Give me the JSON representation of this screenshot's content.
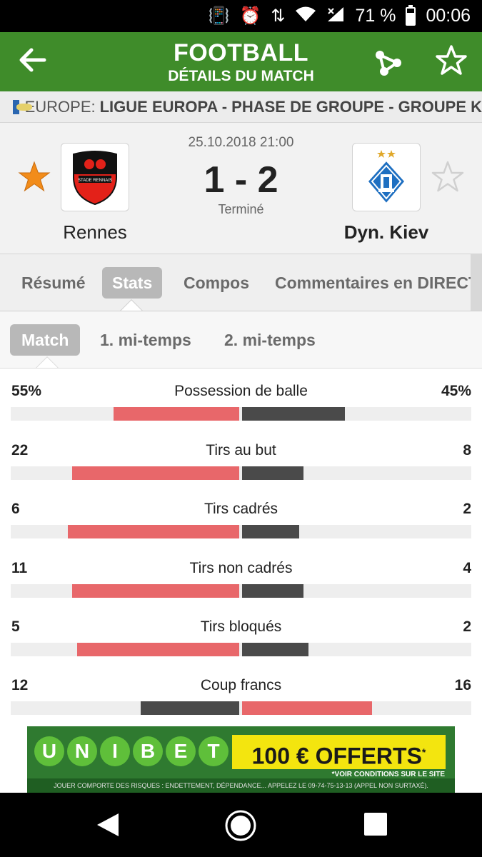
{
  "status_bar": {
    "battery": "71 %",
    "time": "00:06",
    "battery_level": 0.71
  },
  "header": {
    "title": "FOOTBALL",
    "subtitle": "DÉTAILS DU MATCH"
  },
  "competition": {
    "region": "EUROPE:",
    "name": "LIGUE EUROPA - PHASE DE GROUPE - GROUPE K"
  },
  "match": {
    "datetime": "25.10.2018 21:00",
    "score": "1 - 2",
    "status": "Terminé",
    "home": {
      "name": "Rennes",
      "logo_text": "STADE RENNAIS",
      "favorite": true
    },
    "away": {
      "name": "Dyn. Kiev",
      "favorite": false
    }
  },
  "tabs": [
    "Résumé",
    "Stats",
    "Compos",
    "Commentaires en DIRECT"
  ],
  "active_tab": "Stats",
  "subtabs": [
    "Match",
    "1. mi-temps",
    "2. mi-temps"
  ],
  "active_subtab": "Match",
  "stats": [
    {
      "label": "Possession de balle",
      "home": "55%",
      "away": "45%",
      "home_share": 0.55,
      "away_share": 0.45,
      "home_leads": true
    },
    {
      "label": "Tirs au but",
      "home": "22",
      "away": "8",
      "home_share": 0.73,
      "away_share": 0.27,
      "home_leads": true
    },
    {
      "label": "Tirs cadrés",
      "home": "6",
      "away": "2",
      "home_share": 0.75,
      "away_share": 0.25,
      "home_leads": true
    },
    {
      "label": "Tirs non cadrés",
      "home": "11",
      "away": "4",
      "home_share": 0.73,
      "away_share": 0.27,
      "home_leads": true
    },
    {
      "label": "Tirs bloqués",
      "home": "5",
      "away": "2",
      "home_share": 0.71,
      "away_share": 0.29,
      "home_leads": true
    },
    {
      "label": "Coup francs",
      "home": "12",
      "away": "16",
      "home_share": 0.43,
      "away_share": 0.57,
      "home_leads": false
    }
  ],
  "colors": {
    "header_green": "#3f8c2a",
    "lead_red": "#e8676a",
    "trail_gray": "#4a4a4a",
    "star_orange": "#f28c1a"
  },
  "ad": {
    "brand_letters": [
      "U",
      "N",
      "I",
      "B",
      "E",
      "T"
    ],
    "offer": "100 € OFFERTS",
    "offer_mark": "*",
    "conditions": "*VOIR CONDITIONS SUR LE SITE",
    "warning": "JOUER COMPORTE DES RISQUES : ENDETTEMENT, DÉPENDANCE... APPELEZ LE 09-74-75-13-13 (APPEL NON SURTAXÉ)."
  }
}
